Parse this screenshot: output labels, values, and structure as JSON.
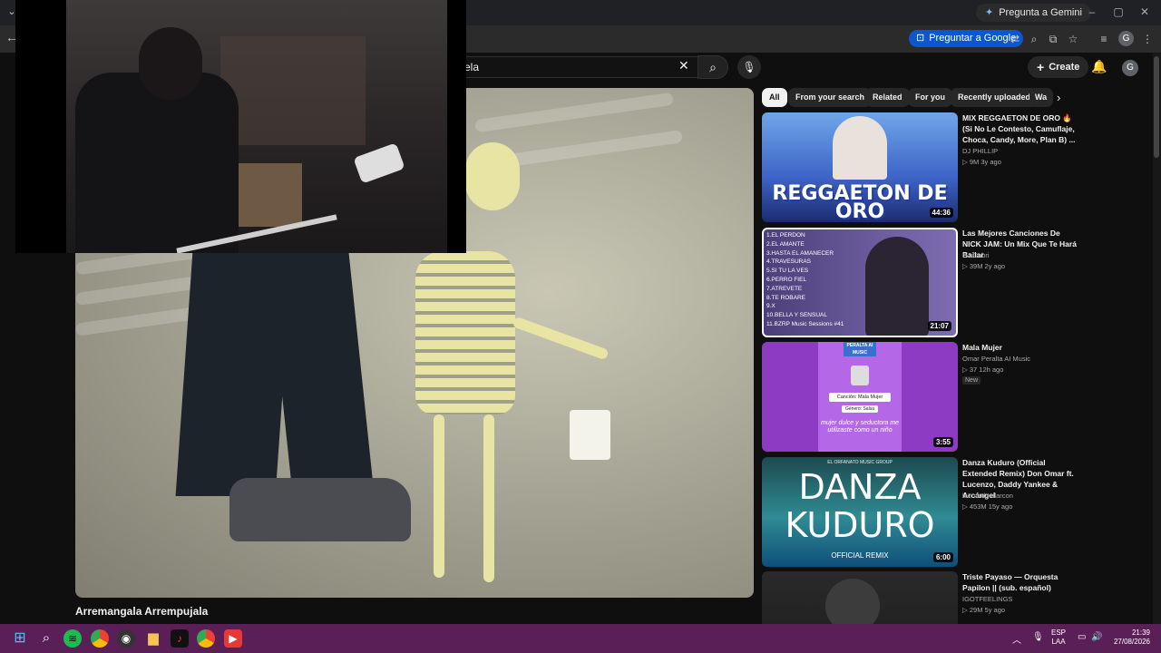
{
  "browser": {
    "gemini_label": "Pregunta a Gemini",
    "ask_google_label": "Preguntar a Google",
    "profile_initial": "G"
  },
  "youtube": {
    "search_value": "ela",
    "create_label": "Create",
    "avatar_initial": "G",
    "video_title": "Arremangala Arrempujala"
  },
  "chips": [
    "All",
    "From your search",
    "Related",
    "For you",
    "Recently uploaded",
    "Wa"
  ],
  "recommendations": [
    {
      "title": "MIX REGGAETON DE ORO 🔥 (Si No Le Contesto, Camuflaje, Choca, Candy, More, Plan B) ...",
      "channel": "DJ PHILLIP",
      "meta": "▷ 9M   3y ago",
      "duration": "44:36",
      "thumb_text": "REGGAETON DE ORO"
    },
    {
      "title": "Las Mejores Canciones De NICK JAM: Un Mix Que Te Hará Bailar",
      "channel": "DJ Gabri",
      "meta": "▷ 39M   2y ago",
      "duration": "21:07",
      "tracklist": [
        "1.EL PERDON",
        "2.EL AMANTE",
        "3.HASTA EL AMANECER",
        "4.TRAVESURAS",
        "5.SI TU LA VES",
        "6.PERRO FIEL",
        "7.ATREVETE",
        "8.TE ROBARE",
        "9.X",
        "10.BELLA Y SENSUAL",
        "11.BZRP Music Sessions #41"
      ]
    },
    {
      "title": "Mala Mujer",
      "channel": "Omar Peralta AI Music",
      "meta": "▷ 37   12h ago",
      "badge": "New",
      "duration": "3:55",
      "thumb_brand": "PERALTA AI MUSIC",
      "thumb_song": "Canción: Mala Mujer",
      "thumb_genre": "Género: Salsa",
      "thumb_lyric": "mujer dulce y seductora me utilizaste como un niño"
    },
    {
      "title": "Danza Kuduro (Official Extended Remix) Don Omar ft. Lucenzo, Daddy Yankee & Arcángel",
      "channel": "leonardo alarcon",
      "meta": "▷ 453M   15y ago",
      "duration": "6:00",
      "thumb_top": "EL ORFANATO MUSIC GROUP",
      "thumb_line1": "DANZA",
      "thumb_line2": "KUDURO",
      "thumb_sub": "OFFICIAL REMIX"
    },
    {
      "title": "Triste Payaso — Orquesta Papilon || (sub. español)",
      "channel": "IGOTFEELINGS",
      "meta": "▷ 29M   5y ago"
    }
  ],
  "taskbar": {
    "lang_1": "ESP",
    "lang_2": "LAA",
    "time": "21:39",
    "date": "27/08/2026"
  },
  "colors": {
    "accent_blue": "#0b57d0",
    "taskbar": "#5b1f58",
    "bg": "#0f0f0f"
  }
}
